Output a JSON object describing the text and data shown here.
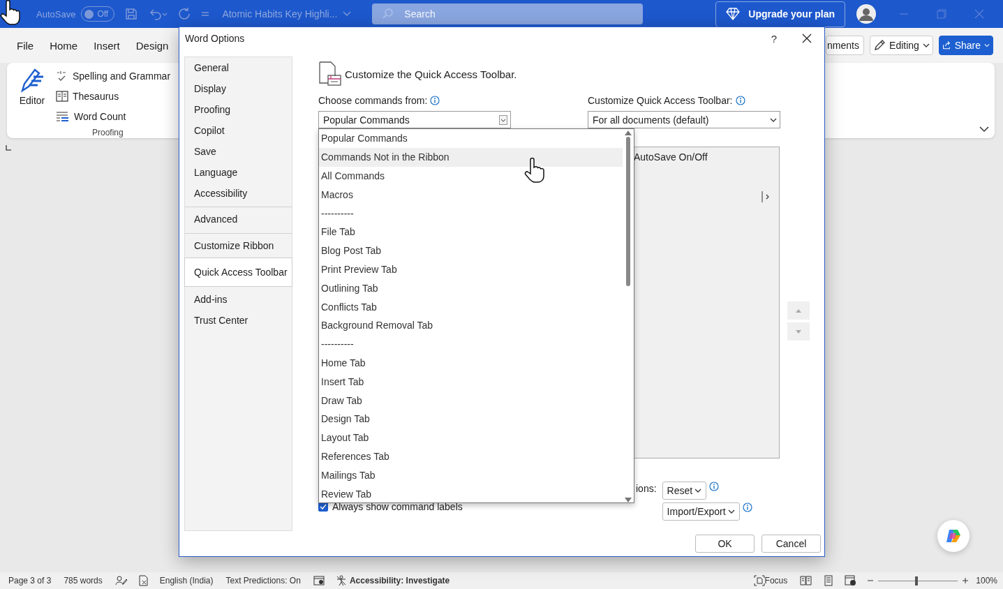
{
  "title_bar": {
    "autosave_label": "AutoSave",
    "autosave_toggle": {
      "label": "Off",
      "on": false
    },
    "document_title": "Atomic Habits Key Highli...",
    "search": {
      "placeholder": "Search"
    },
    "upgrade_button": "Upgrade your plan"
  },
  "ribbon": {
    "tabs": [
      "File",
      "Home",
      "Insert",
      "Design"
    ],
    "comments_button": "nments",
    "editing_button": "Editing",
    "share_button": "Share",
    "group": {
      "editor_button": "Editor",
      "label": "Proofing",
      "commands": [
        {
          "kind": "spelling",
          "label": "Spelling and Grammar"
        },
        {
          "kind": "thesaurus",
          "label": "Thesaurus"
        },
        {
          "kind": "word_count",
          "label": "Word Count"
        }
      ]
    }
  },
  "dialog": {
    "title": "Word Options",
    "help": "?",
    "nav": [
      {
        "label": "General",
        "selected": false,
        "divider_before": false
      },
      {
        "label": "Display",
        "selected": false,
        "divider_before": false
      },
      {
        "label": "Proofing",
        "selected": false,
        "divider_before": false
      },
      {
        "label": "Copilot",
        "selected": false,
        "divider_before": false
      },
      {
        "label": "Save",
        "selected": false,
        "divider_before": false
      },
      {
        "label": "Language",
        "selected": false,
        "divider_before": false
      },
      {
        "label": "Accessibility",
        "selected": false,
        "divider_before": false
      },
      {
        "label": "Advanced",
        "selected": false,
        "divider_before": true
      },
      {
        "label": "Customize Ribbon",
        "selected": false,
        "divider_before": true
      },
      {
        "label": "Quick Access Toolbar",
        "selected": true,
        "divider_before": false
      },
      {
        "label": "Add-ins",
        "selected": false,
        "divider_before": false
      },
      {
        "label": "Trust Center",
        "selected": false,
        "divider_before": false
      }
    ],
    "heading": "Customize the Quick Access Toolbar.",
    "choose_label": "Choose commands from:",
    "choose_select": "Popular Commands",
    "toolbar_label": "Customize Quick Access Toolbar:",
    "toolbar_select": "For all documents (default)",
    "toolbar_commands": [
      "AutoSave On/Off"
    ],
    "customizations_label": "ions:",
    "reset_button": "Reset",
    "import_export_button": "Import/Export",
    "show_labels": {
      "label": "Always show command labels",
      "checked": true
    },
    "ok_button": "OK",
    "cancel_button": "Cancel",
    "dropdown_options": [
      {
        "label": "Popular Commands",
        "highlighted": false
      },
      {
        "label": "Commands Not in the Ribbon",
        "highlighted": true
      },
      {
        "label": "All Commands",
        "highlighted": false
      },
      {
        "label": "Macros",
        "highlighted": false
      },
      {
        "label": "----------",
        "highlighted": false
      },
      {
        "label": "File Tab",
        "highlighted": false
      },
      {
        "label": "Blog Post Tab",
        "highlighted": false
      },
      {
        "label": "Print Preview Tab",
        "highlighted": false
      },
      {
        "label": "Outlining Tab",
        "highlighted": false
      },
      {
        "label": "Conflicts Tab",
        "highlighted": false
      },
      {
        "label": "Background Removal Tab",
        "highlighted": false
      },
      {
        "label": "----------",
        "highlighted": false
      },
      {
        "label": "Home Tab",
        "highlighted": false
      },
      {
        "label": "Insert Tab",
        "highlighted": false
      },
      {
        "label": "Draw Tab",
        "highlighted": false
      },
      {
        "label": "Design Tab",
        "highlighted": false
      },
      {
        "label": "Layout Tab",
        "highlighted": false
      },
      {
        "label": "References Tab",
        "highlighted": false
      },
      {
        "label": "Mailings Tab",
        "highlighted": false
      },
      {
        "label": "Review Tab",
        "highlighted": false
      }
    ]
  },
  "status_bar": {
    "page": "Page 3 of 3",
    "words": "785 words",
    "language": "English (India)",
    "text_predictions": "Text Predictions: On",
    "accessibility": "Accessibility: Investigate",
    "focus": "Focus",
    "zoom": {
      "level": 0.48
    },
    "zoom_percent": "100%"
  }
}
